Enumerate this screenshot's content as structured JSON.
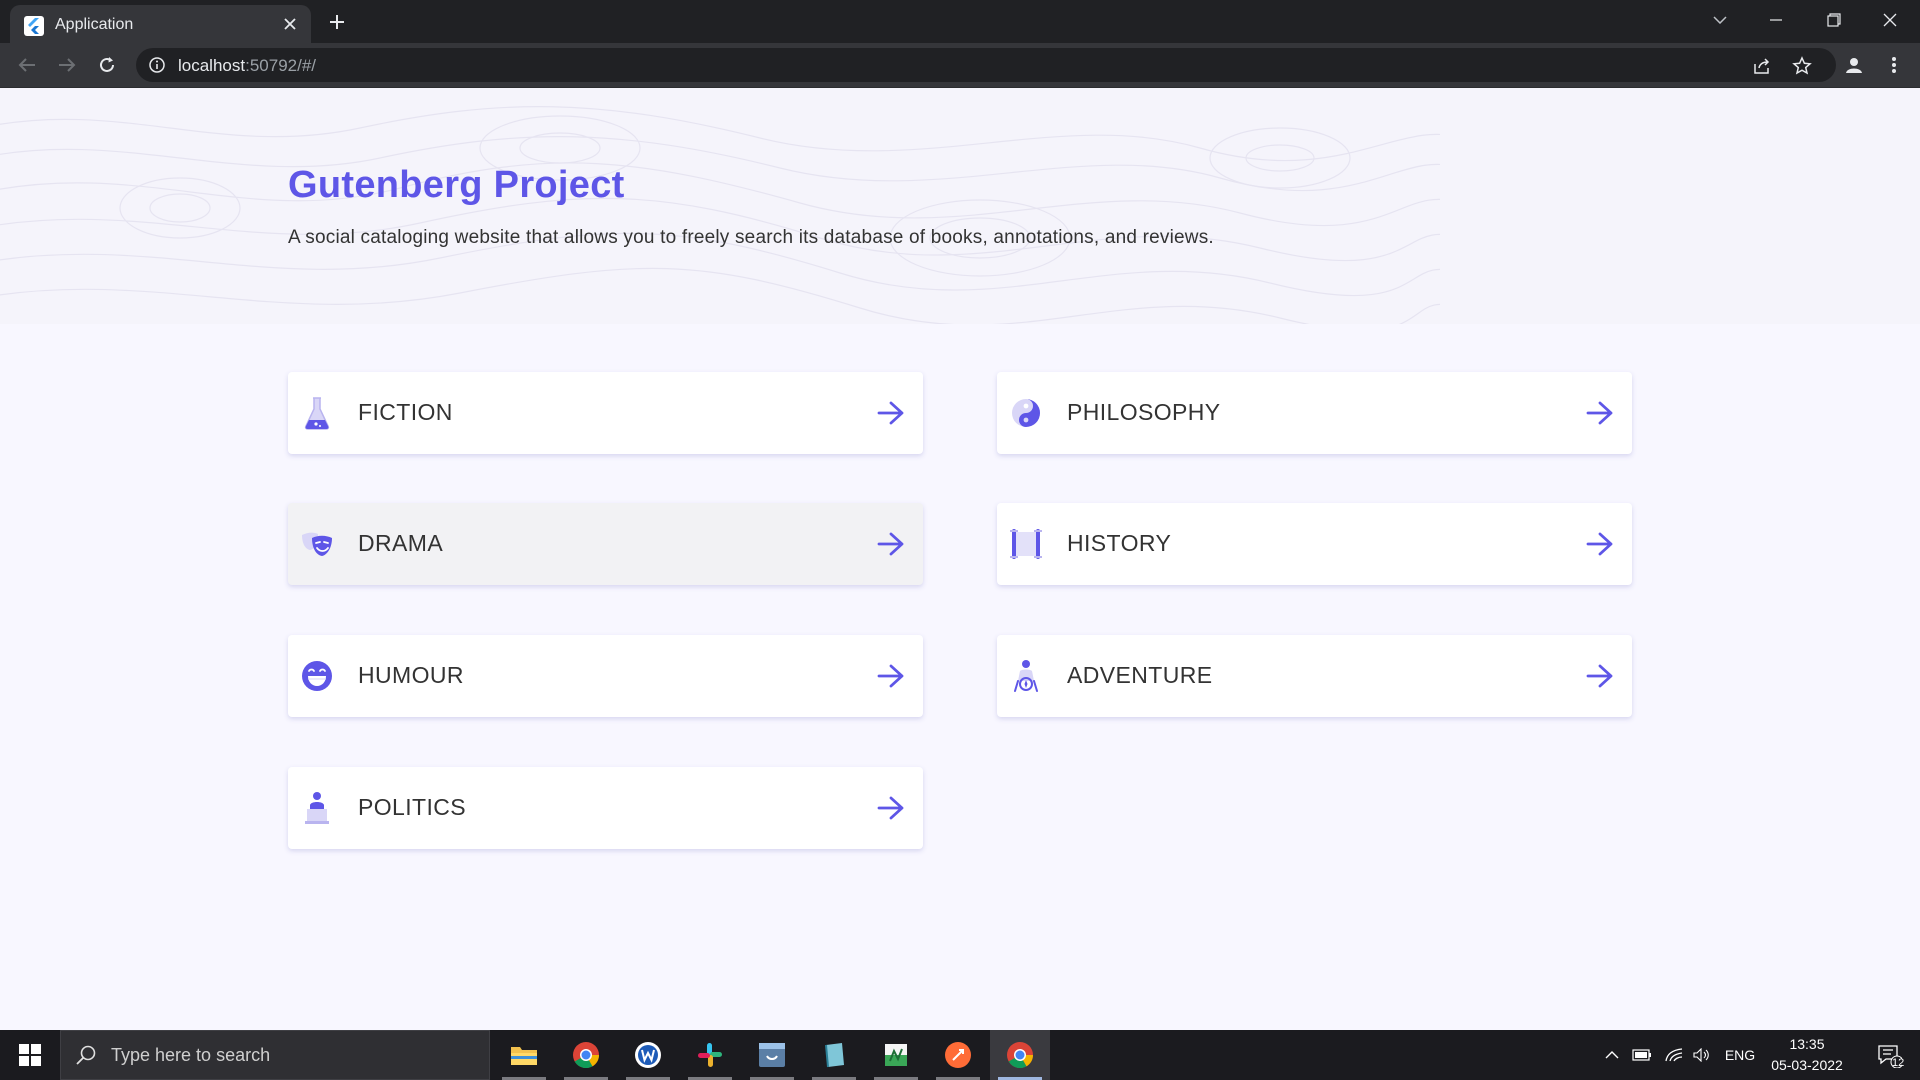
{
  "browser": {
    "tab_title": "Application",
    "url_host": "localhost",
    "url_rest": ":50792/#/"
  },
  "hero": {
    "title": "Gutenberg Project",
    "subtitle": "A social cataloging website that allows you to freely search its database of books, annotations, and reviews."
  },
  "genres": [
    {
      "label": "FICTION",
      "icon": "flask-icon"
    },
    {
      "label": "PHILOSOPHY",
      "icon": "yin-yang-icon"
    },
    {
      "label": "DRAMA",
      "icon": "theatre-masks-icon"
    },
    {
      "label": "HISTORY",
      "icon": "scroll-icon"
    },
    {
      "label": "HUMOUR",
      "icon": "laughing-face-icon"
    },
    {
      "label": "ADVENTURE",
      "icon": "adventurer-icon"
    },
    {
      "label": "POLITICS",
      "icon": "politician-icon"
    }
  ],
  "taskbar": {
    "search_placeholder": "Type here to search",
    "language": "ENG",
    "time": "13:35",
    "date": "05-03-2022",
    "notification_count": "12"
  },
  "colors": {
    "accent": "#5e56e7",
    "card_hover": "#f2f2f4",
    "page_bg": "#f8f7ff"
  }
}
